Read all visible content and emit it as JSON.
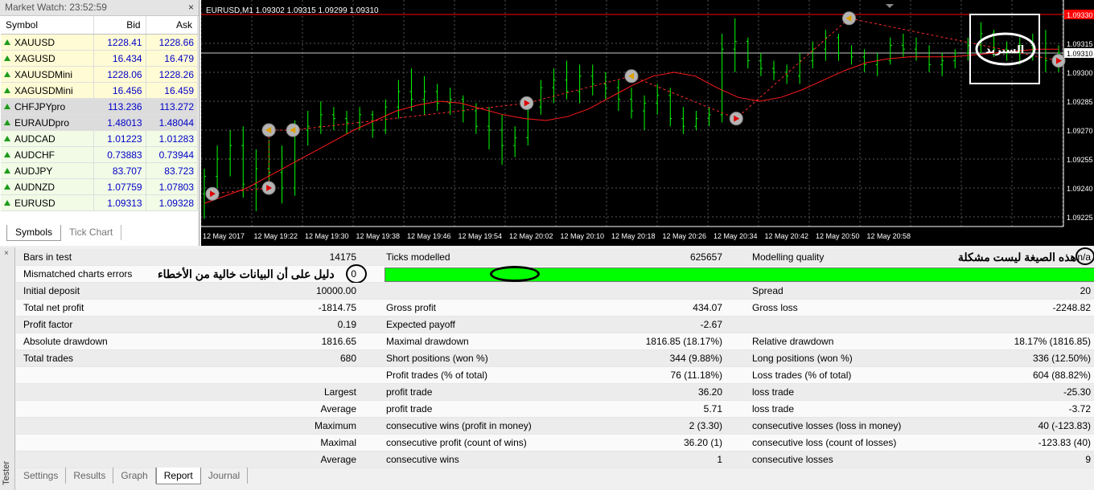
{
  "market_watch": {
    "title": "Market Watch: 23:52:59",
    "close": "×",
    "columns": [
      "Symbol",
      "Bid",
      "Ask"
    ],
    "rows": [
      {
        "symbol": "XAUUSD",
        "bid": "1228.41",
        "ask": "1228.66"
      },
      {
        "symbol": "XAGUSD",
        "bid": "16.434",
        "ask": "16.479"
      },
      {
        "symbol": "XAUUSDMini",
        "bid": "1228.06",
        "ask": "1228.26"
      },
      {
        "symbol": "XAGUSDMini",
        "bid": "16.456",
        "ask": "16.459"
      },
      {
        "symbol": "CHFJPYpro",
        "bid": "113.236",
        "ask": "113.272"
      },
      {
        "symbol": "EURAUDpro",
        "bid": "1.48013",
        "ask": "1.48044"
      },
      {
        "symbol": "AUDCAD",
        "bid": "1.01223",
        "ask": "1.01283"
      },
      {
        "symbol": "AUDCHF",
        "bid": "0.73883",
        "ask": "0.73944"
      },
      {
        "symbol": "AUDJPY",
        "bid": "83.707",
        "ask": "83.723"
      },
      {
        "symbol": "AUDNZD",
        "bid": "1.07759",
        "ask": "1.07803"
      },
      {
        "symbol": "EURUSD",
        "bid": "1.09313",
        "ask": "1.09328"
      }
    ],
    "tabs": [
      "Symbols",
      "Tick Chart"
    ]
  },
  "chart": {
    "title": "EURUSD,M1  1.09302 1.09315 1.09299 1.09310",
    "annotation": "السبريد",
    "price_labels": [
      "1.09330",
      "1.09315",
      "1.09310",
      "1.09300",
      "1.09285",
      "1.09270",
      "1.09255",
      "1.09240",
      "1.09225"
    ],
    "time_labels": [
      "12 May 2017",
      "12 May 19:22",
      "12 May 19:30",
      "12 May 19:38",
      "12 May 19:46",
      "12 May 19:54",
      "12 May 20:02",
      "12 May 20:10",
      "12 May 20:18",
      "12 May 20:26",
      "12 May 20:34",
      "12 May 20:42",
      "12 May 20:50",
      "12 May 20:58"
    ],
    "colors": {
      "bars": "#00ff00",
      "ma": "#ff1a1a",
      "trade_line": "#ff1a1a",
      "grid": "#555555",
      "red_level": "#ff0000",
      "current_price": "#ff0000"
    }
  },
  "chart_data": {
    "type": "line",
    "ylim": [
      1.0922,
      1.09335
    ],
    "current_price": 1.0931,
    "red_level": 1.0933,
    "bars": [
      [
        1.09237,
        1.0925,
        1.09224,
        1.09246
      ],
      [
        1.09246,
        1.09262,
        1.0924,
        1.09255
      ],
      [
        1.09255,
        1.0927,
        1.09246,
        1.09262
      ],
      [
        1.09262,
        1.09272,
        1.09235,
        1.09242
      ],
      [
        1.09242,
        1.0926,
        1.09228,
        1.0925
      ],
      [
        1.0925,
        1.09265,
        1.09238,
        1.09248
      ],
      [
        1.09248,
        1.09262,
        1.09232,
        1.0924
      ],
      [
        1.0924,
        1.09275,
        1.09236,
        1.0927
      ],
      [
        1.0927,
        1.0928,
        1.09262,
        1.09272
      ],
      [
        1.09272,
        1.09285,
        1.09268,
        1.09278
      ],
      [
        1.09278,
        1.09282,
        1.0927,
        1.09276
      ],
      [
        1.09276,
        1.0928,
        1.09268,
        1.09274
      ],
      [
        1.09274,
        1.09282,
        1.0927,
        1.09278
      ],
      [
        1.09278,
        1.0928,
        1.09266,
        1.0927
      ],
      [
        1.0927,
        1.09286,
        1.09268,
        1.09282
      ],
      [
        1.09282,
        1.09296,
        1.09276,
        1.0929
      ],
      [
        1.0929,
        1.09302,
        1.0928,
        1.09286
      ],
      [
        1.09286,
        1.09298,
        1.09278,
        1.0929
      ],
      [
        1.0929,
        1.09294,
        1.0928,
        1.09284
      ],
      [
        1.09284,
        1.09292,
        1.09278,
        1.09286
      ],
      [
        1.09286,
        1.09288,
        1.09274,
        1.0928
      ],
      [
        1.0928,
        1.09284,
        1.09268,
        1.09272
      ],
      [
        1.09272,
        1.09282,
        1.0926,
        1.0927
      ],
      [
        1.0927,
        1.09278,
        1.09252,
        1.09262
      ],
      [
        1.09262,
        1.09272,
        1.09256,
        1.09266
      ],
      [
        1.09266,
        1.09286,
        1.09262,
        1.09282
      ],
      [
        1.09282,
        1.09296,
        1.09278,
        1.09292
      ],
      [
        1.09292,
        1.09302,
        1.09284,
        1.09296
      ],
      [
        1.09296,
        1.09306,
        1.09286,
        1.0929
      ],
      [
        1.0929,
        1.09304,
        1.09284,
        1.09298
      ],
      [
        1.09298,
        1.09304,
        1.09288,
        1.09294
      ],
      [
        1.09294,
        1.093,
        1.09286,
        1.09292
      ],
      [
        1.09292,
        1.09296,
        1.0928,
        1.09286
      ],
      [
        1.09286,
        1.09292,
        1.09276,
        1.0928
      ],
      [
        1.0928,
        1.09288,
        1.0927,
        1.09284
      ],
      [
        1.09284,
        1.09294,
        1.09278,
        1.09288
      ],
      [
        1.09288,
        1.09292,
        1.09272,
        1.09276
      ],
      [
        1.09276,
        1.09282,
        1.09268,
        1.09272
      ],
      [
        1.09272,
        1.0928,
        1.0927,
        1.09276
      ],
      [
        1.09276,
        1.09282,
        1.09272,
        1.09278
      ],
      [
        1.09278,
        1.0932,
        1.09274,
        1.09312
      ],
      [
        1.09312,
        1.09328,
        1.093,
        1.09316
      ],
      [
        1.09316,
        1.09318,
        1.09302,
        1.09306
      ],
      [
        1.09306,
        1.0931,
        1.09298,
        1.09302
      ],
      [
        1.09302,
        1.09306,
        1.09296,
        1.093
      ],
      [
        1.093,
        1.09304,
        1.09294,
        1.09298
      ],
      [
        1.09298,
        1.0931,
        1.09294,
        1.09306
      ],
      [
        1.09306,
        1.09316,
        1.09302,
        1.09312
      ],
      [
        1.09312,
        1.09322,
        1.09306,
        1.09318
      ],
      [
        1.09318,
        1.0932,
        1.09306,
        1.0931
      ],
      [
        1.0931,
        1.09314,
        1.09304,
        1.09308
      ],
      [
        1.09308,
        1.09312,
        1.093,
        1.09304
      ],
      [
        1.09304,
        1.0931,
        1.09298,
        1.09306
      ],
      [
        1.09306,
        1.09318,
        1.09304,
        1.09314
      ],
      [
        1.09314,
        1.0932,
        1.09308,
        1.09312
      ],
      [
        1.09312,
        1.09318,
        1.09306,
        1.09308
      ],
      [
        1.09308,
        1.09314,
        1.093,
        1.09304
      ],
      [
        1.09304,
        1.0931,
        1.09298,
        1.09306
      ],
      [
        1.09306,
        1.09312,
        1.09302,
        1.0931
      ],
      [
        1.0931,
        1.09318,
        1.09306,
        1.09314
      ],
      [
        1.09314,
        1.09326,
        1.0931,
        1.0932
      ],
      [
        1.0932,
        1.09322,
        1.09308,
        1.09312
      ],
      [
        1.09312,
        1.09316,
        1.09306,
        1.0931
      ],
      [
        1.0931,
        1.09318,
        1.09304,
        1.09314
      ],
      [
        1.09314,
        1.0932,
        1.09306,
        1.09312
      ],
      [
        1.09312,
        1.09322,
        1.093,
        1.09306
      ],
      [
        1.09306,
        1.09314,
        1.093,
        1.0931
      ]
    ],
    "ma": [
      1.09232,
      1.09236,
      1.0924,
      1.09246,
      1.09252,
      1.09258,
      1.09264,
      1.0927,
      1.09275,
      1.0928,
      1.09283,
      1.09285,
      1.09284,
      1.09281,
      1.09278,
      1.09276,
      1.09275,
      1.09277,
      1.09281,
      1.09287,
      1.09293,
      1.09298,
      1.093,
      1.09298,
      1.09292,
      1.09287,
      1.09285,
      1.09287,
      1.09291,
      1.09296,
      1.09301,
      1.09305,
      1.09307,
      1.09308,
      1.09308,
      1.09308,
      1.09309,
      1.0931,
      1.09311,
      1.09312,
      1.09312
    ],
    "trades": [
      {
        "type": "buy",
        "bar": 1,
        "price": 1.09237
      },
      {
        "type": "buy",
        "bar": 8,
        "price": 1.0924
      },
      {
        "type": "sell",
        "bar": 8,
        "price": 1.0927
      },
      {
        "type": "sell",
        "bar": 11,
        "price": 1.0927
      },
      {
        "type": "buy",
        "bar": 40,
        "price": 1.09284
      },
      {
        "type": "sell",
        "bar": 53,
        "price": 1.09298
      },
      {
        "type": "buy",
        "bar": 66,
        "price": 1.09276
      },
      {
        "type": "sell",
        "bar": 80,
        "price": 1.09328
      },
      {
        "type": "buy",
        "bar": 106,
        "price": 1.09306
      }
    ]
  },
  "report": {
    "rows": [
      {
        "l1": "Bars in test",
        "v1": "14175",
        "l2": "Ticks modelled",
        "v2": "625657",
        "l3": "Modelling quality",
        "v3": "n/a"
      },
      {
        "l1": "Mismatched charts errors",
        "v1": "0",
        "l2": "",
        "v2": "",
        "l3": "",
        "v3": ""
      },
      {
        "l1": "Initial deposit",
        "v1": "10000.00",
        "l2": "",
        "v2": "",
        "l3": "Spread",
        "v3": "20"
      },
      {
        "l1": "Total net profit",
        "v1": "-1814.75",
        "l2": "Gross profit",
        "v2": "434.07",
        "l3": "Gross loss",
        "v3": "-2248.82"
      },
      {
        "l1": "Profit factor",
        "v1": "0.19",
        "l2": "Expected payoff",
        "v2": "-2.67",
        "l3": "",
        "v3": ""
      },
      {
        "l1": "Absolute drawdown",
        "v1": "1816.65",
        "l2": "Maximal drawdown",
        "v2": "1816.85 (18.17%)",
        "l3": "Relative drawdown",
        "v3": "18.17% (1816.85)"
      },
      {
        "l1": "Total trades",
        "v1": "680",
        "l2": "Short positions (won %)",
        "v2": "344 (9.88%)",
        "l3": "Long positions (won %)",
        "v3": "336 (12.50%)"
      },
      {
        "l1": "",
        "v1": "",
        "l2": "Profit trades (% of total)",
        "v2": "76 (11.18%)",
        "l3": "Loss trades (% of total)",
        "v3": "604 (88.82%)"
      },
      {
        "l1": "",
        "v1": "Largest",
        "l2": "profit trade",
        "v2": "36.20",
        "l3": "loss trade",
        "v3": "-25.30"
      },
      {
        "l1": "",
        "v1": "Average",
        "l2": "profit trade",
        "v2": "5.71",
        "l3": "loss trade",
        "v3": "-3.72"
      },
      {
        "l1": "",
        "v1": "Maximum",
        "l2": "consecutive wins (profit in money)",
        "v2": "2 (3.30)",
        "l3": "consecutive losses (loss in money)",
        "v3": "40 (-123.83)"
      },
      {
        "l1": "",
        "v1": "Maximal",
        "l2": "consecutive profit (count of wins)",
        "v2": "36.20 (1)",
        "l3": "consecutive loss (count of losses)",
        "v3": "-123.83 (40)"
      },
      {
        "l1": "",
        "v1": "Average",
        "l2": "consecutive wins",
        "v2": "1",
        "l3": "consecutive losses",
        "v3": "9"
      }
    ],
    "annotation_quality": "هذه الصيغة ليست مشكلة",
    "annotation_errors": "دليل على أن البيانات خالية من الأخطاء"
  },
  "tester": {
    "side_label": "Tester",
    "side_close": "×",
    "tabs": [
      "Settings",
      "Results",
      "Graph",
      "Report",
      "Journal"
    ],
    "active_tab": "Report"
  }
}
